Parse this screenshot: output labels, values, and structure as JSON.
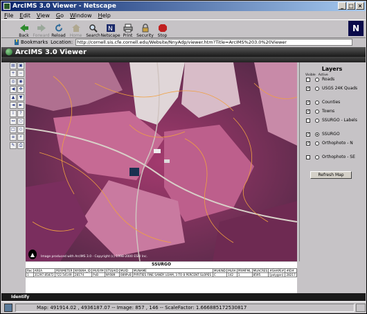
{
  "window": {
    "title": "ArcIMS 3.0 Viewer - Netscape"
  },
  "menu": [
    "File",
    "Edit",
    "View",
    "Go",
    "Window",
    "Help"
  ],
  "toolbar": {
    "back": "Back",
    "forward": "Forward",
    "reload": "Reload",
    "home": "Home",
    "search": "Search",
    "netscape": "Netscape",
    "print": "Print",
    "security": "Security",
    "stop": "Stop"
  },
  "location": {
    "bookmarks_label": "Bookmarks",
    "location_label": "Location:",
    "url": "http://cornell.sis.cfe.cornell.edu/Website/NnyAdp/viewer.htm?Title=ArcIMS%203.0%20Viewer"
  },
  "viewer": {
    "title": "ArcIMS 3.0 Viewer"
  },
  "map": {
    "copyright": "Image produced with ArcIMS 3.0 - Copyright (c) 1998-2000 ESRI Inc."
  },
  "layers": {
    "heading": "Layers",
    "visible_col": "Visible",
    "active_col": "Active",
    "items": [
      {
        "label": "Roads",
        "visible": false,
        "active": false
      },
      {
        "label": "USGS 24K Quads",
        "visible": true,
        "active": false
      },
      {
        "label": "Counties",
        "visible": true,
        "active": false
      },
      {
        "label": "Towns",
        "visible": true,
        "active": false
      },
      {
        "label": "SSURGO - Labels",
        "visible": false,
        "active": false
      },
      {
        "label": "SSURGO",
        "visible": true,
        "active": true
      },
      {
        "label": "Orthophoto - N",
        "visible": true,
        "active": false
      },
      {
        "label": "Orthophoto - SE",
        "visible": false,
        "active": false
      }
    ],
    "refresh_label": "Refresh Map"
  },
  "results": {
    "title": "SSURGO",
    "columns": [
      "Rec",
      "AREA",
      "PERIMETER",
      "NY089A_ID",
      "MUSYM",
      "STSSAID",
      "MUID",
      "MUNAME",
      "MUKIND",
      "MLRA",
      "PRIMFML",
      "MUACRES",
      "#SHAPE#",
      "#ID#"
    ],
    "rows": [
      [
        "1",
        "31297.85872",
        "722.54149",
        "28174",
        "PvB",
        "NY089",
        "089PvB",
        "PYRITIES FINE SANDY LOAM, 3 TO 8 PERCENT SLOPES",
        "C",
        "142",
        "1",
        "8595",
        "[polygon]",
        "28217"
      ]
    ]
  },
  "identify": {
    "label": "Identify"
  },
  "status": {
    "text": "Map: 491914.02 , 4936187.07 -- Image: 857 , 146 -- ScaleFactor: 1.666885172530817"
  }
}
